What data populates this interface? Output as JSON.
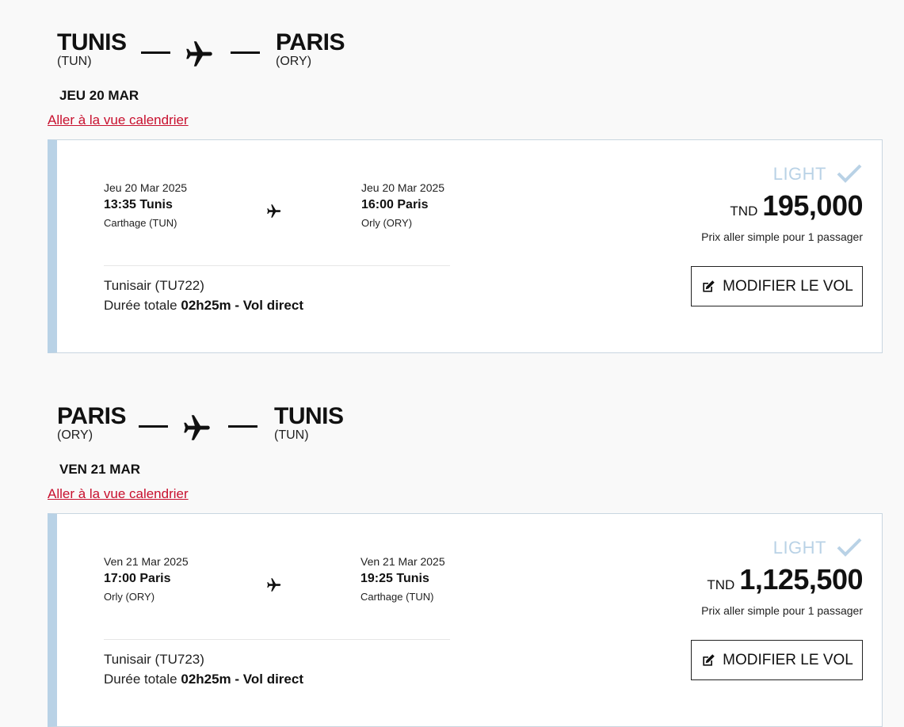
{
  "outbound": {
    "origin_city": "TUNIS",
    "origin_code": "(TUN)",
    "dest_city": "PARIS",
    "dest_code": "(ORY)",
    "date_label": "JEU 20 MAR",
    "calendar_link": "Aller à la vue calendrier",
    "flight": {
      "dep_date": "Jeu 20 Mar 2025",
      "dep_time_city": "13:35 Tunis",
      "dep_airport": "Carthage (TUN)",
      "arr_date": "Jeu 20 Mar 2025",
      "arr_time_city": "16:00 Paris",
      "arr_airport": "Orly (ORY)",
      "airline": "Tunisair (TU722)",
      "duration_prefix": "Durée totale",
      "duration_value": "02h25m - Vol direct",
      "fare_class": "LIGHT",
      "currency": "TND",
      "price": "195,000",
      "price_note": "Prix aller simple pour 1 passager",
      "modify_label": "MODIFIER LE VOL"
    }
  },
  "return": {
    "origin_city": "PARIS",
    "origin_code": "(ORY)",
    "dest_city": "TUNIS",
    "dest_code": "(TUN)",
    "date_label": "VEN 21 MAR",
    "calendar_link": "Aller à la vue calendrier",
    "flight": {
      "dep_date": "Ven 21 Mar 2025",
      "dep_time_city": "17:00 Paris",
      "dep_airport": "Orly (ORY)",
      "arr_date": "Ven 21 Mar 2025",
      "arr_time_city": "19:25 Tunis",
      "arr_airport": "Carthage (TUN)",
      "airline": "Tunisair (TU723)",
      "duration_prefix": "Durée totale",
      "duration_value": "02h25m - Vol direct",
      "fare_class": "LIGHT",
      "currency": "TND",
      "price": "1,125,500",
      "price_note": "Prix aller simple pour 1 passager",
      "modify_label": "MODIFIER LE VOL"
    }
  },
  "icons": {
    "plane": "plane-icon",
    "check": "check-icon",
    "edit": "edit-icon"
  },
  "colors": {
    "link": "#c8102e",
    "card_accent": "#b9d2e6",
    "background": "#f9f9f9"
  }
}
